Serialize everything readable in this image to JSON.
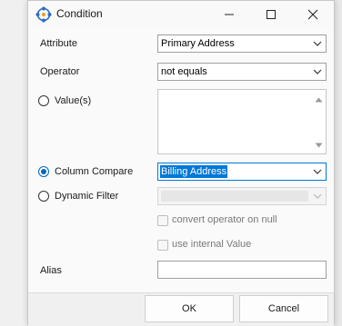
{
  "window": {
    "title": "Condition",
    "icon": "condition-app-icon",
    "controls": [
      "minimize-icon",
      "maximize-icon",
      "close-icon"
    ]
  },
  "form": {
    "attribute": {
      "label": "Attribute",
      "value": "Primary Address"
    },
    "operator": {
      "label": "Operator",
      "value": "not equals"
    },
    "value_option": {
      "label": "Value(s)",
      "selected": false,
      "text": ""
    },
    "column_compare": {
      "label": "Column Compare",
      "selected": true,
      "value": "Billing Address"
    },
    "dynamic_filter": {
      "label": "Dynamic Filter",
      "selected": false,
      "value": ""
    },
    "convert_operator": {
      "label": "convert operator on null",
      "checked": false
    },
    "use_internal_value": {
      "label": "use internal Value",
      "checked": false
    },
    "alias": {
      "label": "Alias",
      "value": ""
    }
  },
  "buttons": {
    "ok": "OK",
    "cancel": "Cancel"
  },
  "colors": {
    "accent": "#0078d7",
    "radio_selected": "#0067c0",
    "disabled_text": "#7a7a7a"
  }
}
